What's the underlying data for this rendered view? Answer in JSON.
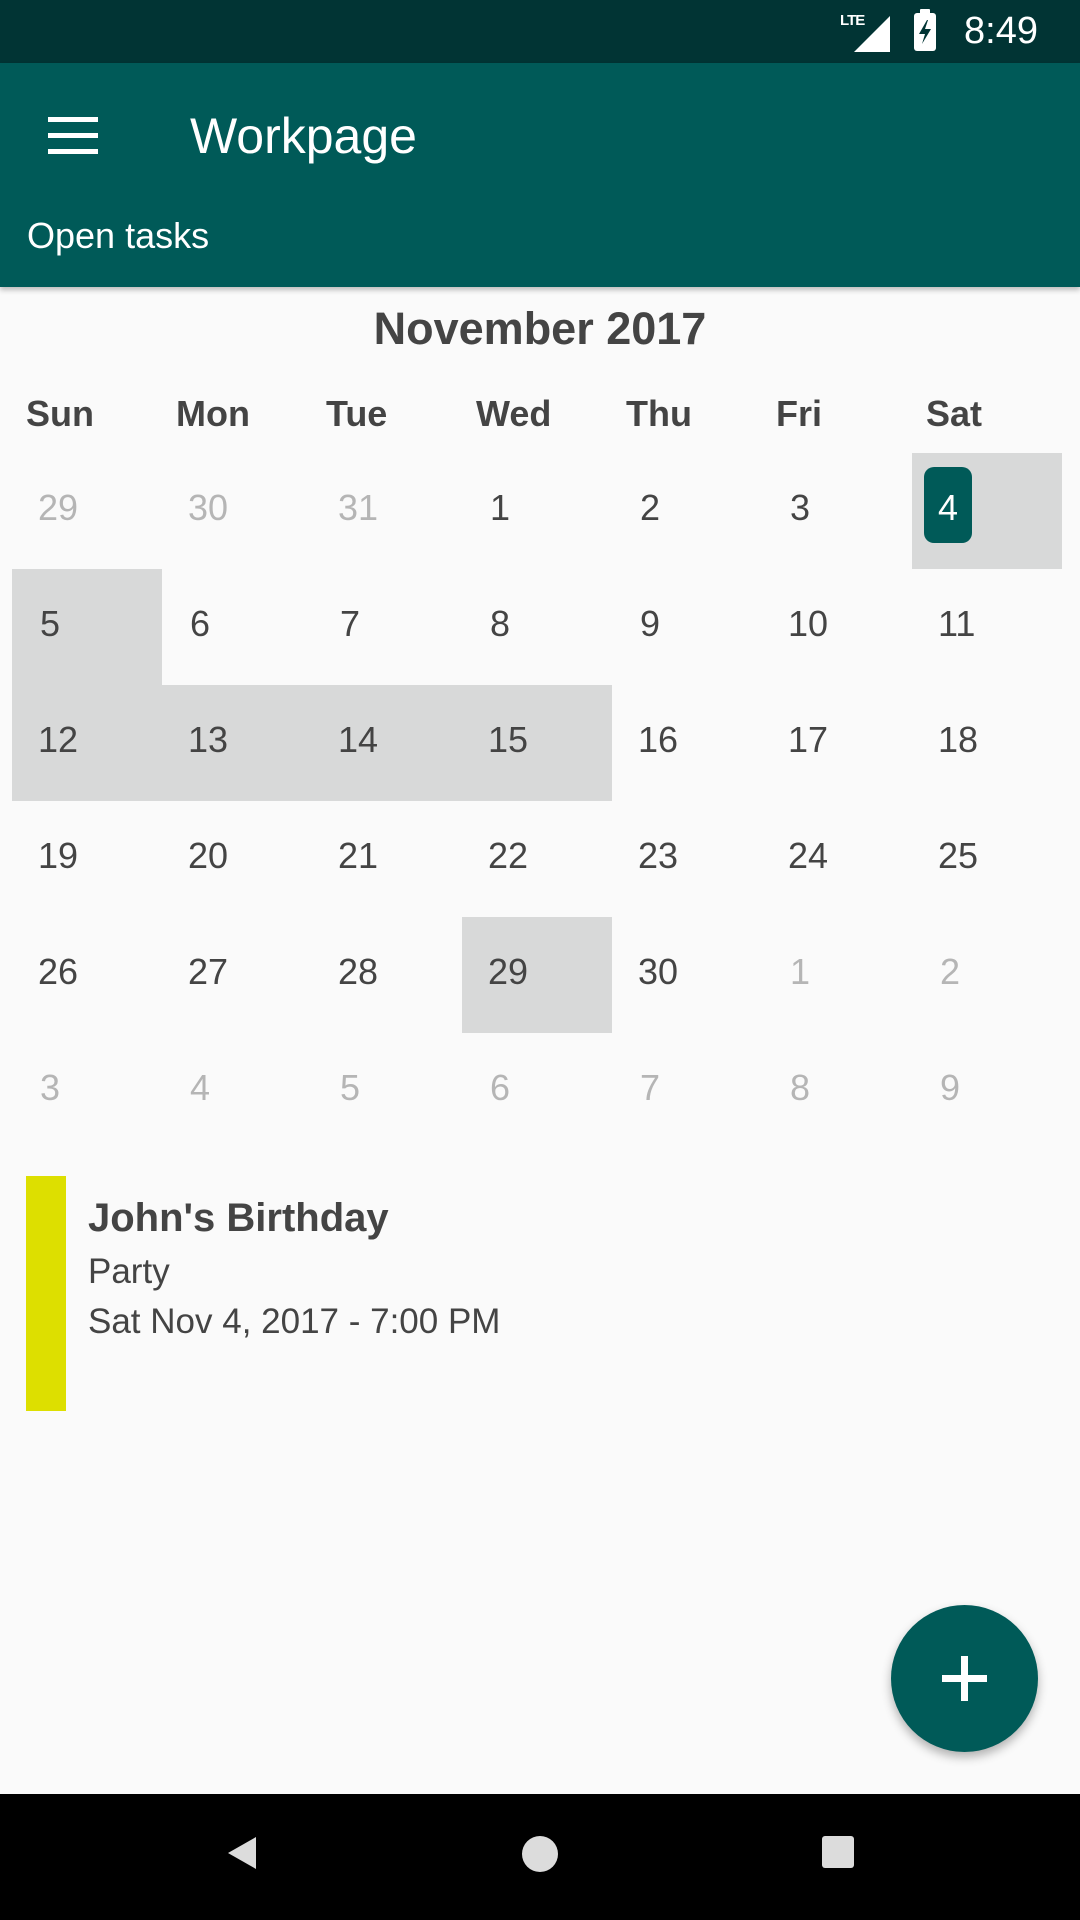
{
  "status_bar": {
    "network": "LTE",
    "time": "8:49",
    "icons": [
      "lte-icon",
      "signal-icon",
      "battery-charging-icon"
    ]
  },
  "app_bar": {
    "menu_icon": "menu-icon",
    "title": "Workpage",
    "subtitle": "Open tasks"
  },
  "calendar": {
    "month_title": "November 2017",
    "weekdays": [
      "Sun",
      "Mon",
      "Tue",
      "Wed",
      "Thu",
      "Fri",
      "Sat"
    ],
    "weeks": [
      [
        "29",
        "30",
        "31",
        "1",
        "2",
        "3",
        "4"
      ],
      [
        "5",
        "6",
        "7",
        "8",
        "9",
        "10",
        "11"
      ],
      [
        "12",
        "13",
        "14",
        "15",
        "16",
        "17",
        "18"
      ],
      [
        "19",
        "20",
        "21",
        "22",
        "23",
        "24",
        "25"
      ],
      [
        "26",
        "27",
        "28",
        "29",
        "30",
        "1",
        "2"
      ],
      [
        "3",
        "4",
        "5",
        "6",
        "7",
        "8",
        "9"
      ]
    ],
    "muted_days": [
      [
        0,
        0
      ],
      [
        0,
        1
      ],
      [
        0,
        2
      ],
      [
        4,
        5
      ],
      [
        4,
        6
      ],
      [
        5,
        0
      ],
      [
        5,
        1
      ],
      [
        5,
        2
      ],
      [
        5,
        3
      ],
      [
        5,
        4
      ],
      [
        5,
        5
      ],
      [
        5,
        6
      ]
    ],
    "highlighted_days": [
      [
        0,
        6
      ],
      [
        1,
        0
      ],
      [
        2,
        0
      ],
      [
        2,
        1
      ],
      [
        2,
        2
      ],
      [
        2,
        3
      ],
      [
        4,
        3
      ]
    ],
    "today": [
      0,
      6
    ],
    "colors": {
      "highlight": "#d8d9d9",
      "today_badge": "#005a58"
    }
  },
  "event": {
    "title": "John's Birthday",
    "subtitle": "Party",
    "datetime": "Sat Nov 4, 2017 - 7:00 PM",
    "color": "#dddf00"
  },
  "fab": {
    "icon": "plus-icon"
  },
  "nav_bar": {
    "icons": [
      "back-icon",
      "home-icon",
      "recents-icon"
    ]
  },
  "colors": {
    "status_bar": "#013434",
    "app_bar": "#005a58",
    "background": "#fafafa",
    "text": "#444444"
  }
}
